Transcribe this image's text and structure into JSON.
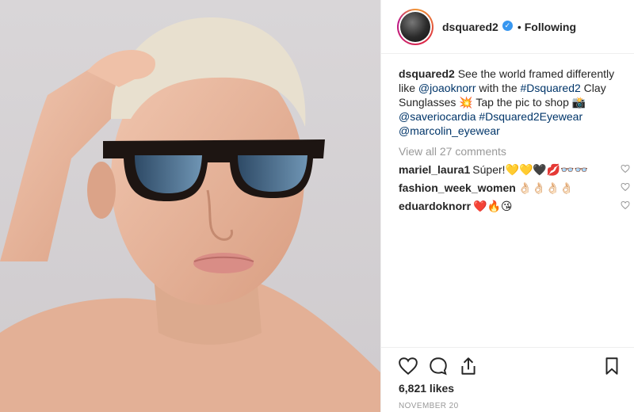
{
  "post": {
    "username": "dsquared2",
    "verified_icon": "verified-badge-icon",
    "separator": "•",
    "follow_status": "Following",
    "caption": {
      "user": "dsquared2",
      "t1": " See the world framed differently like ",
      "mention1": "@joaoknorr",
      "t2": " with the ",
      "hashtag1": "#Dsquared2",
      "t3": " Clay Sunglasses ",
      "emoji1": "💥",
      "t4": " Tap the pic to shop ",
      "emoji2": "📸",
      "t5": " ",
      "mention2": "@saveriocardia",
      "t6": " ",
      "hashtag2": "#Dsquared2Eyewear",
      "t7": " ",
      "mention3": "@marcolin_eyewear"
    },
    "view_all": "View all 27 comments",
    "comments": [
      {
        "user": "mariel_laura1",
        "text": "Súper!💛💛🖤💋👓👓"
      },
      {
        "user": "fashion_week_women",
        "text": "👌🏻👌🏻👌🏻👌🏻"
      },
      {
        "user": "eduardoknorr",
        "text": "❤️🔥😘"
      }
    ],
    "likes": "6,821 likes",
    "date": "NOVEMBER 20"
  },
  "icons": {
    "like": "heart-icon",
    "comment": "comment-icon",
    "share": "share-icon",
    "save": "bookmark-icon"
  },
  "colors": {
    "link": "#003569",
    "muted": "#999999",
    "verified": "#3897f0",
    "text": "#262626"
  }
}
